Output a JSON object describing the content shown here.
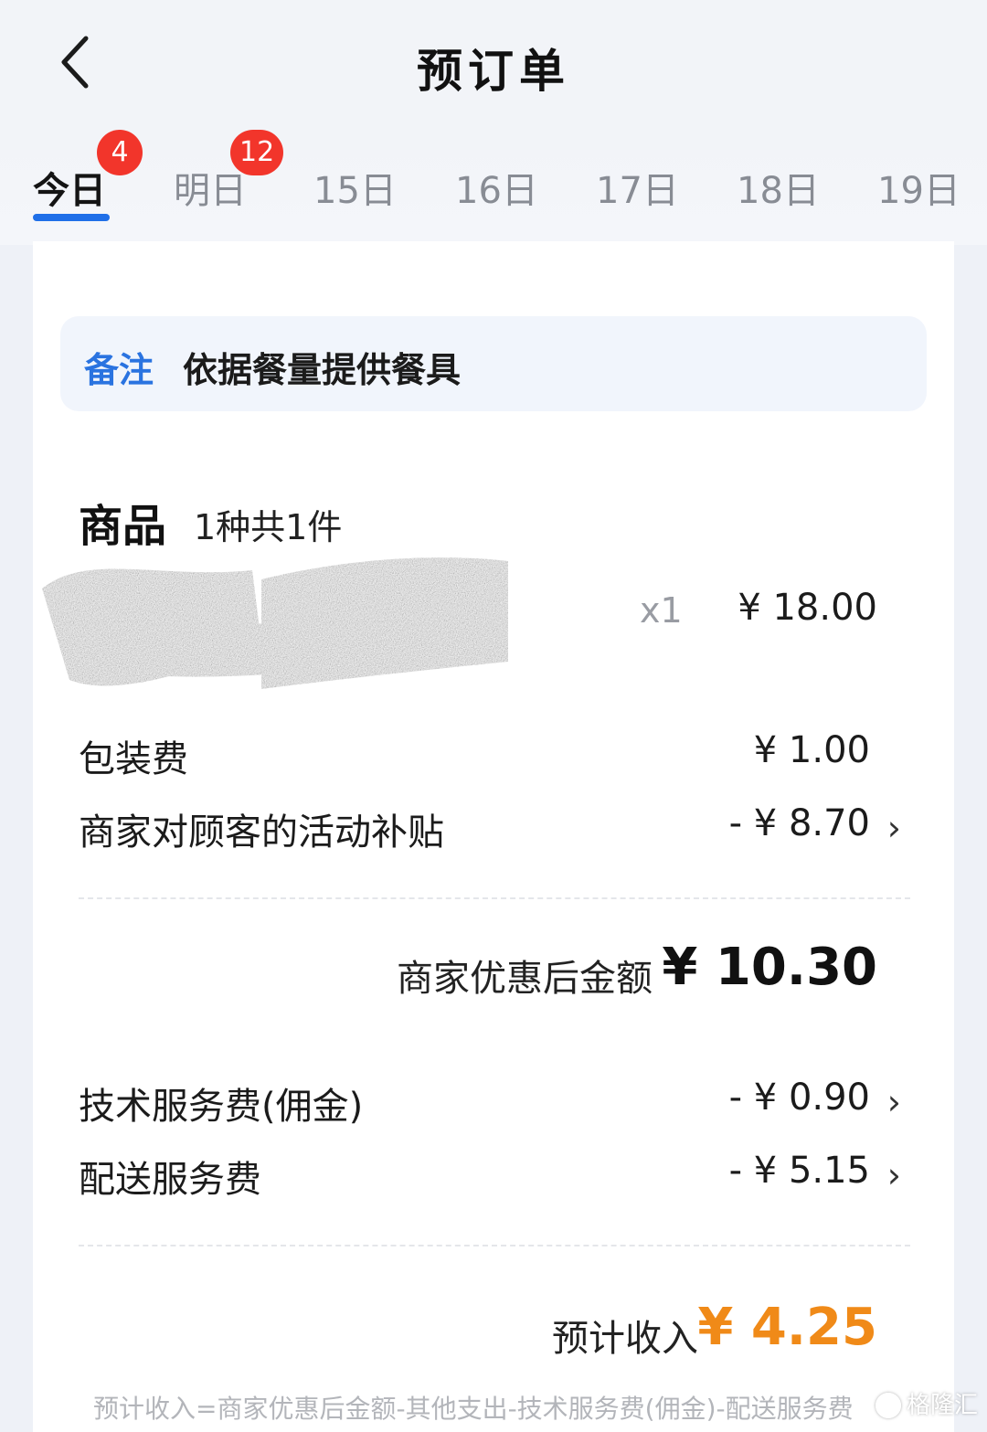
{
  "header": {
    "title": "预订单"
  },
  "tabs": [
    {
      "label": "今日",
      "badge": "4",
      "active": true
    },
    {
      "label": "明日",
      "badge": "12",
      "active": false
    },
    {
      "label": "15日",
      "badge": "",
      "active": false
    },
    {
      "label": "16日",
      "badge": "",
      "active": false
    },
    {
      "label": "17日",
      "badge": "",
      "active": false
    },
    {
      "label": "18日",
      "badge": "",
      "active": false
    },
    {
      "label": "19日",
      "badge": "",
      "active": false
    }
  ],
  "order": {
    "note": {
      "label": "备注",
      "text": "依据餐量提供餐具"
    },
    "goods": {
      "title": "商品",
      "count": "1种共1件",
      "item": {
        "quantity": "x1",
        "price": "¥ 18.00"
      }
    },
    "fees": [
      {
        "label": "包装费",
        "value": "¥ 1.00"
      },
      {
        "label": "商家对顾客的活动补贴",
        "value": "- ¥ 8.70"
      }
    ],
    "subtotal": {
      "label": "商家优惠后金额",
      "value": "¥ 10.30"
    },
    "deductions": [
      {
        "label": "技术服务费(佣金)",
        "value": "- ¥ 0.90"
      },
      {
        "label": "配送服务费",
        "value": "- ¥ 5.15"
      }
    ],
    "income": {
      "label": "预计收入",
      "value": "¥ 4.25"
    },
    "formula": "预计收入=商家优惠后金额-其他支出-技术服务费(佣金)-配送服务费"
  },
  "watermark": "格隆汇",
  "colors": {
    "accent": "#1f6fe8",
    "badge": "#f2352b",
    "income": "#f08a18"
  }
}
